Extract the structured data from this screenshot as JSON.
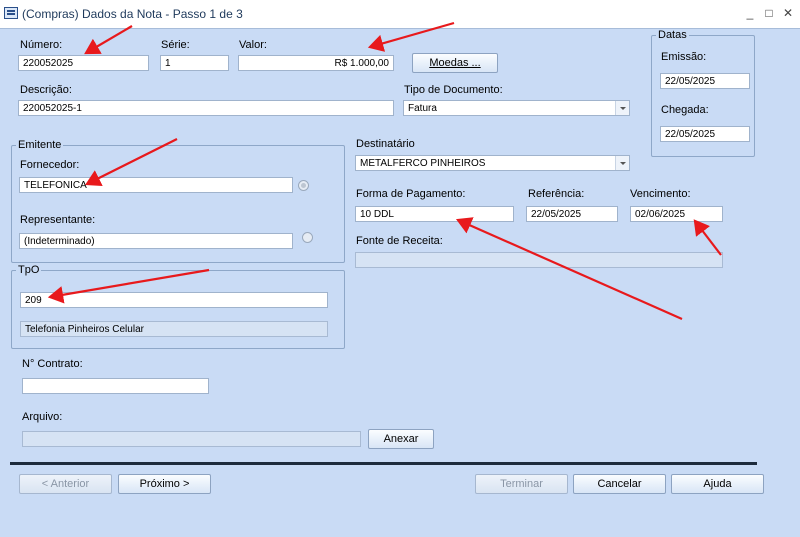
{
  "window": {
    "title": "(Compras) Dados da Nota - Passo 1 de 3",
    "minimize": "_",
    "maximize": "□",
    "close": "✕",
    "icon": "app-form-icon"
  },
  "numero": {
    "label": "Número:",
    "value": "220052025"
  },
  "serie": {
    "label": "Série:",
    "value": "1"
  },
  "valor": {
    "label": "Valor:",
    "value": "R$ 1.000,00"
  },
  "moedas_button": "Moedas ...",
  "descricao": {
    "label": "Descrição:",
    "value": "220052025-1"
  },
  "tipo_documento": {
    "label": "Tipo de Documento:",
    "value": "Fatura"
  },
  "datas": {
    "legend": "Datas",
    "emissao_label": "Emissão:",
    "emissao_value": "22/05/2025",
    "chegada_label": "Chegada:",
    "chegada_value": "22/05/2025"
  },
  "emitente": {
    "legend": "Emitente",
    "fornecedor_label": "Fornecedor:",
    "fornecedor_value": "TELEFONICA",
    "representante_label": "Representante:",
    "representante_value": "(Indeterminado)"
  },
  "destinatario": {
    "label": "Destinatário",
    "value": "METALFERCO PINHEIROS"
  },
  "forma_pagamento": {
    "label": "Forma de Pagamento:",
    "value": "10 DDL"
  },
  "referencia": {
    "label": "Referência:",
    "value": "22/05/2025"
  },
  "vencimento": {
    "label": "Vencimento:",
    "value": "02/06/2025"
  },
  "fonte_receita": {
    "label": "Fonte de Receita:",
    "value": ""
  },
  "tpo": {
    "legend": "TpO",
    "code": "209",
    "description": "Telefonia Pinheiros Celular"
  },
  "contrato": {
    "label": "N° Contrato:",
    "value": ""
  },
  "arquivo": {
    "label": "Arquivo:",
    "value": "",
    "attach_button": "Anexar"
  },
  "footer": {
    "anterior": "< Anterior",
    "proximo": "Próximo >",
    "terminar": "Terminar",
    "cancelar": "Cancelar",
    "ajuda": "Ajuda"
  },
  "colors": {
    "background": "#c9dbf5",
    "annotation_arrow": "#e8191c"
  }
}
